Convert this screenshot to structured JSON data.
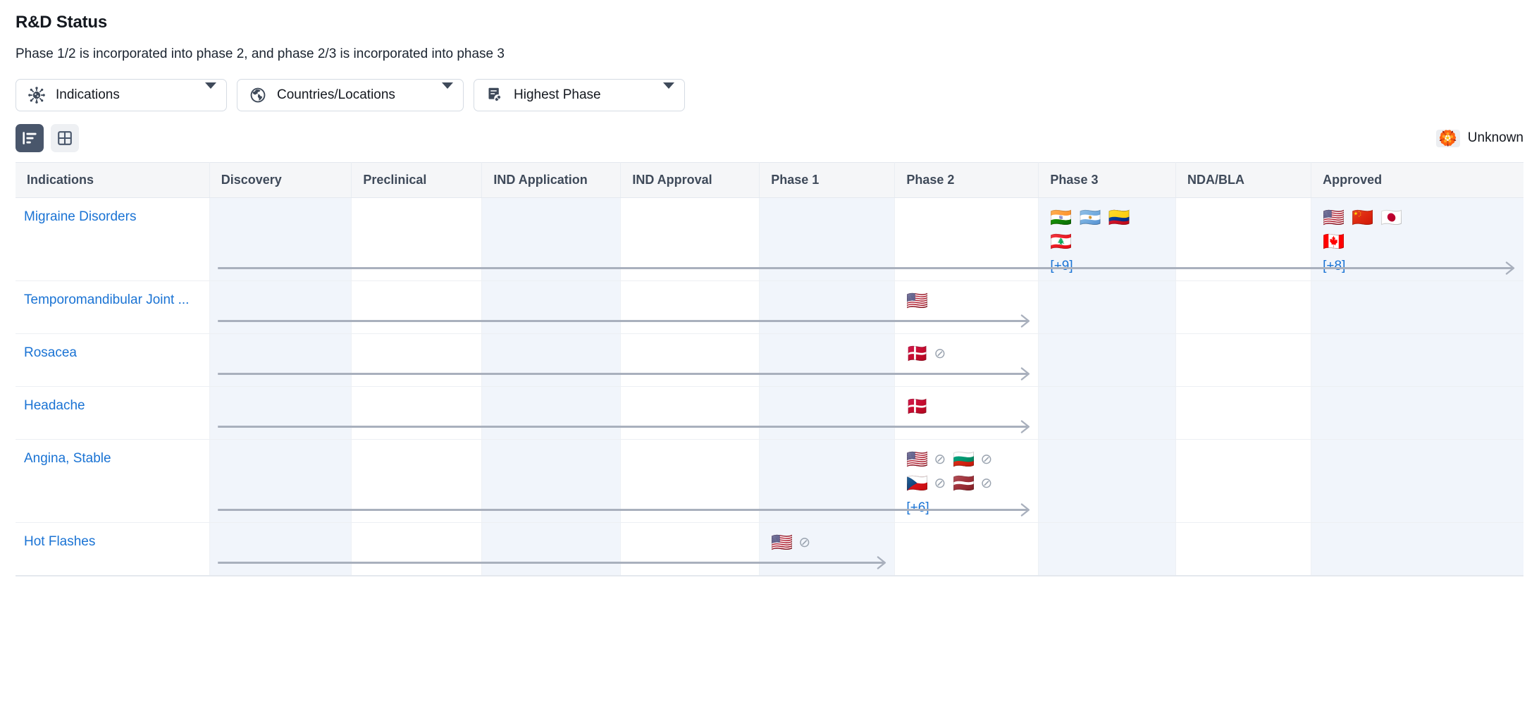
{
  "header": {
    "title": "R&D Status",
    "subtitle": "Phase 1/2 is incorporated into phase 2, and phase 2/3 is incorporated into phase 3"
  },
  "filters": [
    {
      "id": "indications",
      "label": "Indications",
      "icon": "virus-icon"
    },
    {
      "id": "countries",
      "label": "Countries/Locations",
      "icon": "globe-icon"
    },
    {
      "id": "highest-phase",
      "label": "Highest Phase",
      "icon": "document-pill-icon"
    }
  ],
  "toolbar": {
    "views": [
      {
        "id": "chart-view",
        "icon": "bar-list-icon",
        "active": true
      },
      {
        "id": "grid-view",
        "icon": "grid-icon",
        "active": false
      }
    ],
    "legend": {
      "flag": "🏵️",
      "label": "Unknown"
    }
  },
  "table": {
    "columns": [
      "Indications",
      "Discovery",
      "Preclinical",
      "IND Application",
      "IND Approval",
      "Phase 1",
      "Phase 2",
      "Phase 3",
      "NDA/BLA",
      "Approved"
    ],
    "rows": [
      {
        "indication": "Migraine Disorders",
        "progress_to": 9,
        "cells": {
          "7": {
            "flags": [
              {
                "flag": "🇮🇳",
                "name": "india-flag",
                "banned": false
              },
              {
                "flag": "🇦🇷",
                "name": "argentina-flag",
                "banned": false
              },
              {
                "flag": "🇨🇴",
                "name": "colombia-flag",
                "banned": false
              },
              {
                "flag": "🇱🇧",
                "name": "lebanon-flag",
                "banned": false
              }
            ],
            "more": "[+9]"
          },
          "9": {
            "flags": [
              {
                "flag": "🇺🇸",
                "name": "united-states-flag",
                "banned": false
              },
              {
                "flag": "🇨🇳",
                "name": "china-flag",
                "banned": false
              },
              {
                "flag": "🇯🇵",
                "name": "japan-flag",
                "banned": false
              },
              {
                "flag": "🇨🇦",
                "name": "canada-flag",
                "banned": false
              }
            ],
            "more": "[+8]"
          }
        }
      },
      {
        "indication": "Temporomandibular Joint ...",
        "progress_to": 6,
        "cells": {
          "6": {
            "flags": [
              {
                "flag": "🇺🇸",
                "name": "united-states-flag",
                "banned": false
              }
            ],
            "more": ""
          }
        }
      },
      {
        "indication": "Rosacea",
        "progress_to": 6,
        "cells": {
          "6": {
            "flags": [
              {
                "flag": "🇩🇰",
                "name": "denmark-flag",
                "banned": true
              }
            ],
            "more": ""
          }
        }
      },
      {
        "indication": "Headache",
        "progress_to": 6,
        "cells": {
          "6": {
            "flags": [
              {
                "flag": "🇩🇰",
                "name": "denmark-flag",
                "banned": false
              }
            ],
            "more": ""
          }
        }
      },
      {
        "indication": "Angina, Stable",
        "progress_to": 6,
        "cells": {
          "6": {
            "flags": [
              {
                "flag": "🇺🇸",
                "name": "united-states-flag",
                "banned": true
              },
              {
                "flag": "🇧🇬",
                "name": "bulgaria-flag",
                "banned": true
              },
              {
                "flag": "🇨🇿",
                "name": "czech-republic-flag",
                "banned": true
              },
              {
                "flag": "🇱🇻",
                "name": "latvia-flag",
                "banned": true
              }
            ],
            "more": "[+6]"
          }
        }
      },
      {
        "indication": "Hot Flashes",
        "progress_to": 5,
        "cells": {
          "5": {
            "flags": [
              {
                "flag": "🇺🇸",
                "name": "united-states-flag",
                "banned": true
              }
            ],
            "more": ""
          }
        }
      }
    ]
  },
  "colors": {
    "link": "#1a73d4",
    "header_text": "#3f4a5a",
    "shade": "#f1f5fb",
    "arrow": "#a9b0bd",
    "active_toggle": "#49566b"
  }
}
